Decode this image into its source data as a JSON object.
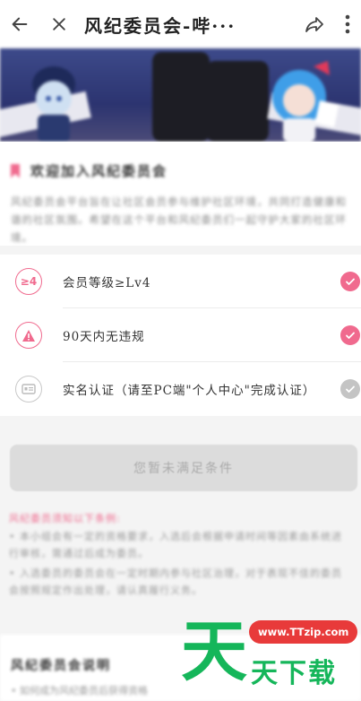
{
  "header": {
    "title": "风纪委员会-哔···",
    "back_icon": "back-arrow-icon",
    "close_icon": "close-icon",
    "share_icon": "share-icon",
    "more_icon": "more-vertical-icon"
  },
  "intro": {
    "title": "欢迎加入风纪委员会",
    "text": "风纪委员会平台旨在让社区会员参与维护社区环境，共同打造健康和谐的社区氛围。希望在这个平台和风纪委员们一起守护大家的社区环境。"
  },
  "conditions": [
    {
      "icon_text": "≥4",
      "label": "会员等级≥Lv4",
      "met": true
    },
    {
      "icon_text": "!",
      "label": "90天内无违规",
      "met": true
    },
    {
      "icon_text": "",
      "label": "实名认证（请至PC端\"个人中心\"完成认证）",
      "met": false
    }
  ],
  "apply_button": {
    "label": "您暂未满足条件"
  },
  "notes": {
    "title": "风纪委员须知以下条例:",
    "items": [
      "• 本小组会有一定的资格要求，入选后会根据申请时间等因素由系统进行审核，需通过后成为委员。",
      "• 入选委员的委员会在一定时期内参与社区治理，对于表现不佳的委员会按照规定作出处理，请认真履行义务。"
    ]
  },
  "rules": {
    "title": "风纪委员会说明",
    "first_line": "• 如何成为风纪委员后获得资格"
  },
  "watermark": {
    "url": "www.TTzip.com",
    "big_char": "天",
    "small_text": "天下载"
  },
  "colors": {
    "accent_pink": "#f06a8e",
    "disabled_grey": "#c4c4c4",
    "watermark_green": "#15b65a",
    "watermark_red": "#e83a3a"
  }
}
